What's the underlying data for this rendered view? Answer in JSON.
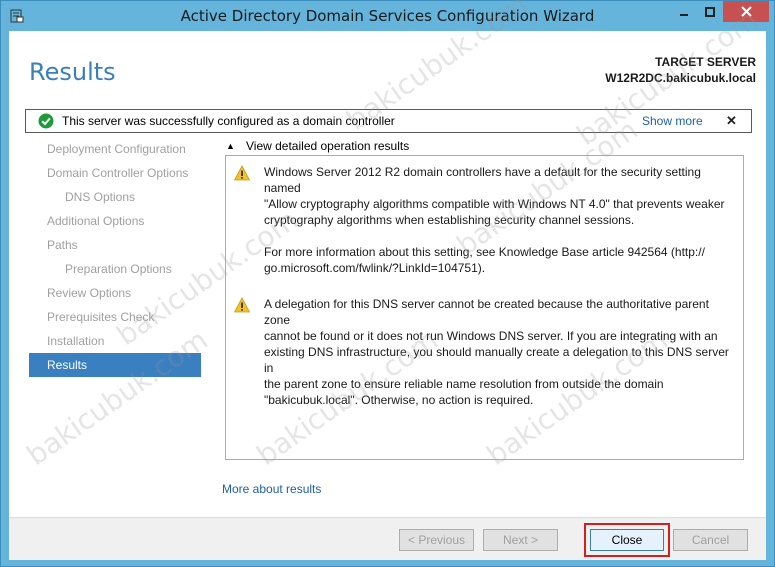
{
  "window": {
    "title": "Active Directory Domain Services Configuration Wizard",
    "minimize_icon": "minimize-icon",
    "maximize_icon": "maximize-icon",
    "close_icon": "close-icon"
  },
  "header": {
    "page_title": "Results",
    "target_label": "TARGET SERVER",
    "target_server": "W12R2DC.bakicubuk.local"
  },
  "banner": {
    "message": "This server was successfully configured as a domain controller",
    "show_more": "Show more",
    "dismiss": "✕"
  },
  "nav": {
    "items": [
      {
        "label": "Deployment Configuration"
      },
      {
        "label": "Domain Controller Options"
      },
      {
        "label": "DNS Options"
      },
      {
        "label": "Additional Options"
      },
      {
        "label": "Paths"
      },
      {
        "label": "Preparation Options"
      },
      {
        "label": "Review Options"
      },
      {
        "label": "Prerequisites Check"
      },
      {
        "label": "Installation"
      },
      {
        "label": "Results"
      }
    ]
  },
  "details": {
    "toggle_label": "View detailed operation results",
    "messages": [
      {
        "text1": "Windows Server 2012 R2 domain controllers have a default for the security setting named\n\"Allow cryptography algorithms compatible with Windows NT 4.0\" that prevents weaker\ncryptography algorithms when establishing security channel sessions.",
        "text2": "For more information about this setting, see Knowledge Base article 942564 (http://\ngo.microsoft.com/fwlink/?LinkId=104751)."
      },
      {
        "text1": "A delegation for this DNS server cannot be created because the authoritative parent zone\ncannot be found or it does not run Windows DNS server. If you are integrating with an\nexisting DNS infrastructure, you should manually create a delegation to this DNS server in\nthe parent zone to ensure reliable name resolution from outside the domain\n\"bakicubuk.local\". Otherwise, no action is required."
      }
    ],
    "more_link": "More about results"
  },
  "footer": {
    "previous": "< Previous",
    "next": "Next >",
    "close": "Close",
    "cancel": "Cancel"
  },
  "watermark": "bakicubuk.com",
  "colors": {
    "title_bar": "#64b4dc",
    "accent": "#3b7fb8",
    "nav_selected": "#3a7fbf",
    "close_highlight": "#d21f1f",
    "link": "#1f5fa8"
  }
}
